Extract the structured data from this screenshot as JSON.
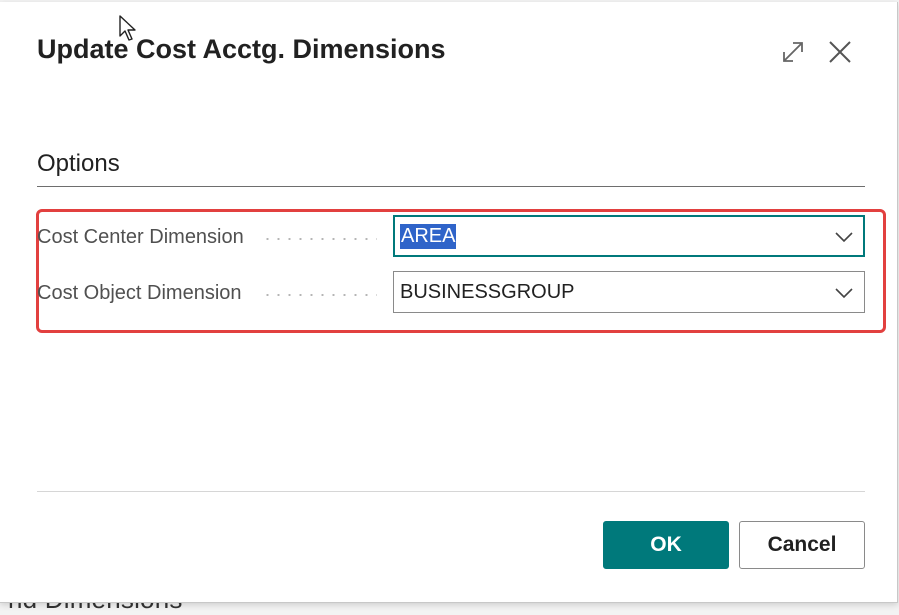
{
  "backdrop": {
    "text": "nd Dimensions"
  },
  "dialog": {
    "title": "Update Cost Acctg. Dimensions",
    "expand_icon": "expand-icon",
    "close_icon": "close-icon"
  },
  "options": {
    "section_title": "Options",
    "fields": [
      {
        "label": "Cost Center Dimension",
        "value": "AREA"
      },
      {
        "label": "Cost Object Dimension",
        "value": "BUSINESSGROUP"
      }
    ]
  },
  "footer": {
    "ok_label": "OK",
    "cancel_label": "Cancel"
  },
  "colors": {
    "accent": "#00797b",
    "highlight": "#e2403f",
    "selection": "#2f64c9"
  }
}
